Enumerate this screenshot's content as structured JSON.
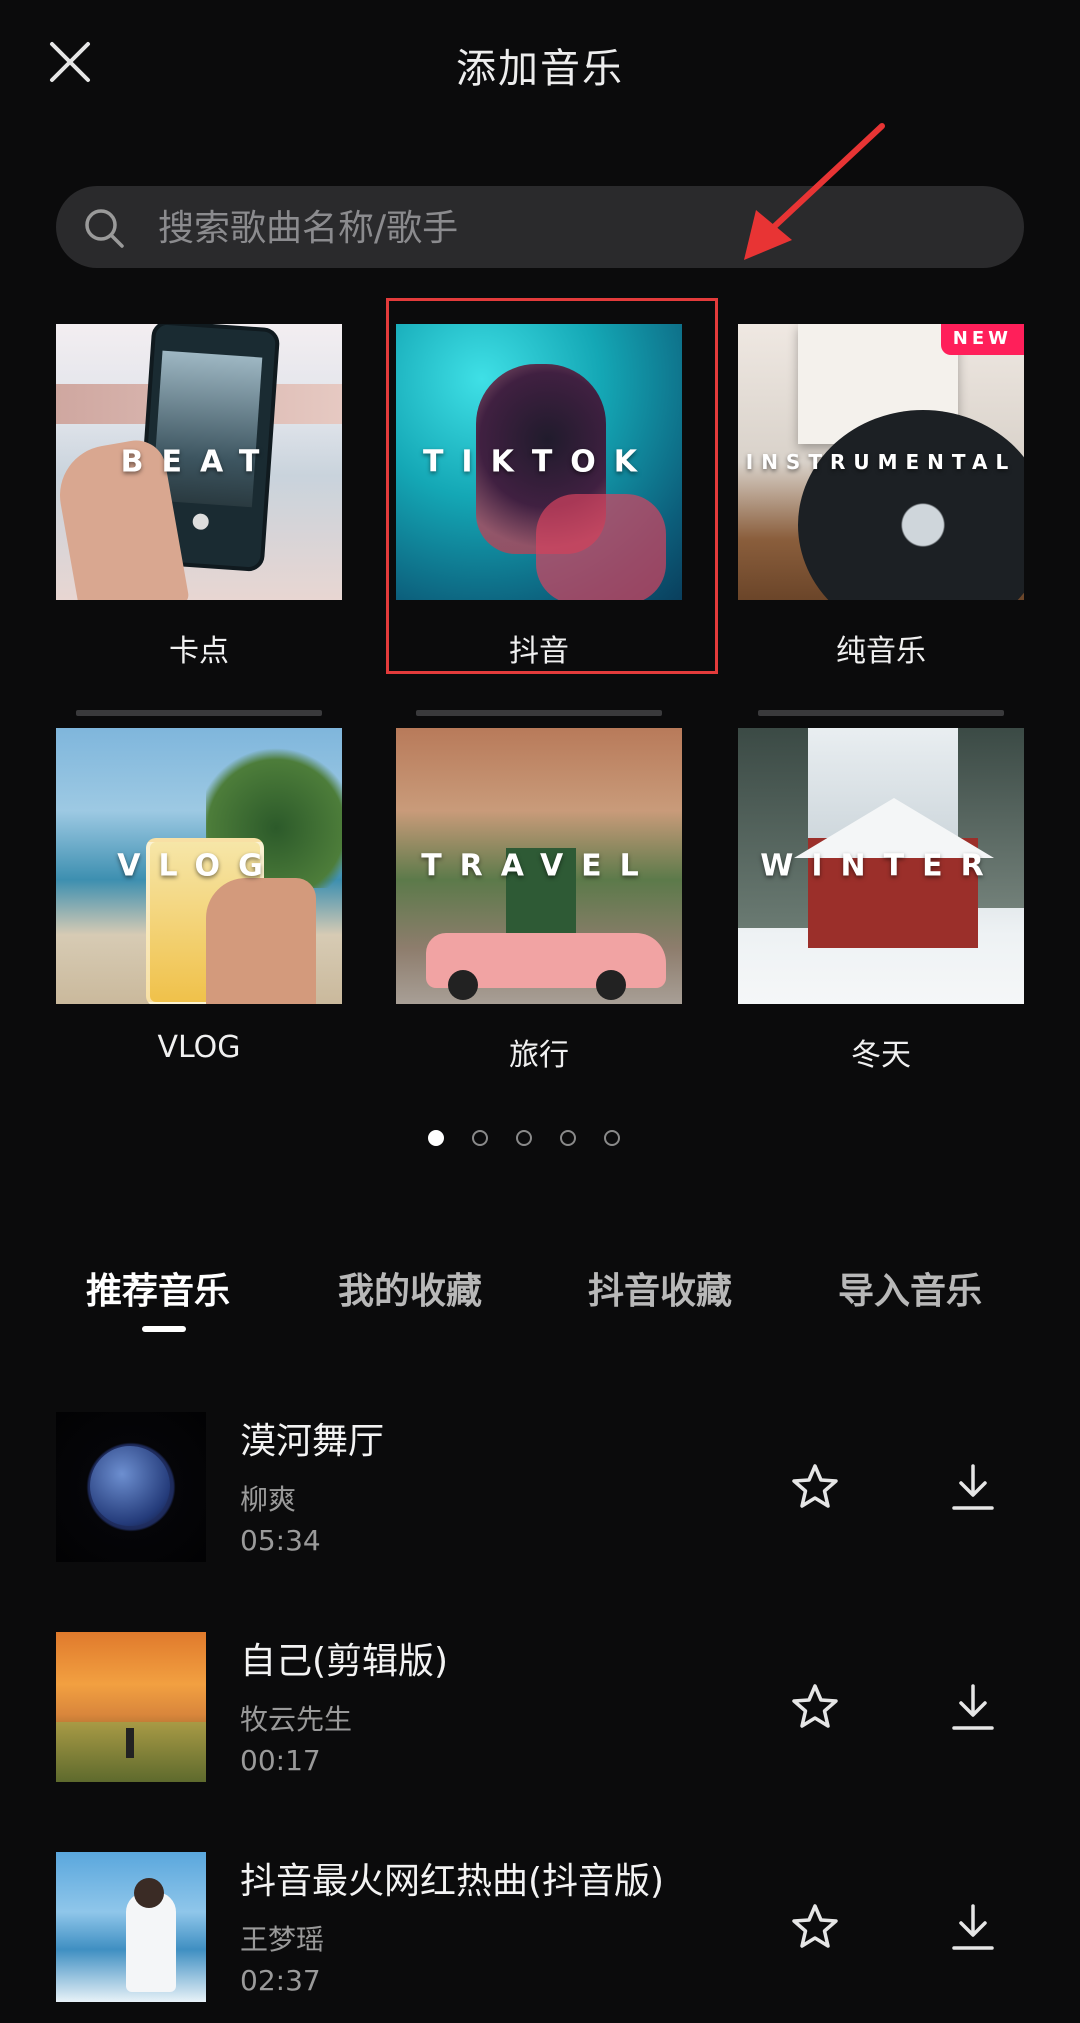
{
  "header": {
    "title": "添加音乐",
    "close_icon": "close-icon"
  },
  "search": {
    "placeholder": "搜索歌曲名称/歌手",
    "icon": "search-icon"
  },
  "categories": [
    {
      "overlay": "BEAT",
      "label": "卡点"
    },
    {
      "overlay": "TIKTOK",
      "label": "抖音"
    },
    {
      "overlay": "INSTRUMENTAL",
      "label": "纯音乐",
      "badge": "NEW"
    },
    {
      "overlay": "VLOG",
      "label": "VLOG"
    },
    {
      "overlay": "TRAVEL",
      "label": "旅行"
    },
    {
      "overlay": "WINTER",
      "label": "冬天"
    }
  ],
  "pager": {
    "total": 5,
    "active_index": 0
  },
  "tabs": [
    {
      "label": "推荐音乐",
      "active": true
    },
    {
      "label": "我的收藏",
      "active": false
    },
    {
      "label": "抖音收藏",
      "active": false
    },
    {
      "label": "导入音乐",
      "active": false
    }
  ],
  "songs": [
    {
      "title": "漠河舞厅",
      "artist": "柳爽",
      "duration": "05:34"
    },
    {
      "title": "自己(剪辑版)",
      "artist": "牧云先生",
      "duration": "00:17"
    },
    {
      "title": "抖音最火网红热曲(抖音版)",
      "artist": "王梦瑶",
      "duration": "02:37"
    }
  ],
  "colors": {
    "background": "#0b0b0c",
    "highlight": "#e33b3b",
    "badge": "#ff1f5a"
  }
}
